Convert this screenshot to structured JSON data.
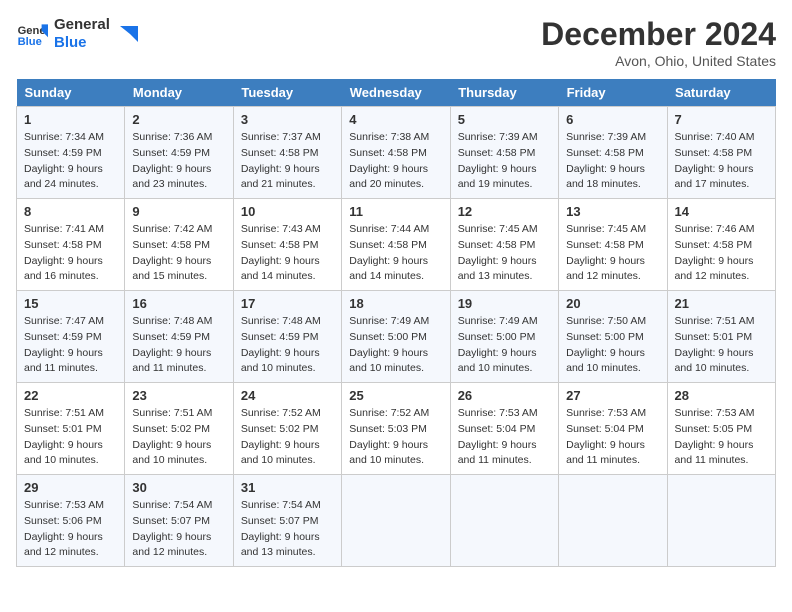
{
  "logo": {
    "line1": "General",
    "line2": "Blue"
  },
  "title": "December 2024",
  "location": "Avon, Ohio, United States",
  "days_of_week": [
    "Sunday",
    "Monday",
    "Tuesday",
    "Wednesday",
    "Thursday",
    "Friday",
    "Saturday"
  ],
  "weeks": [
    [
      {
        "day": 1,
        "sunrise": "7:34 AM",
        "sunset": "4:59 PM",
        "daylight": "9 hours and 24 minutes."
      },
      {
        "day": 2,
        "sunrise": "7:36 AM",
        "sunset": "4:59 PM",
        "daylight": "9 hours and 23 minutes."
      },
      {
        "day": 3,
        "sunrise": "7:37 AM",
        "sunset": "4:58 PM",
        "daylight": "9 hours and 21 minutes."
      },
      {
        "day": 4,
        "sunrise": "7:38 AM",
        "sunset": "4:58 PM",
        "daylight": "9 hours and 20 minutes."
      },
      {
        "day": 5,
        "sunrise": "7:39 AM",
        "sunset": "4:58 PM",
        "daylight": "9 hours and 19 minutes."
      },
      {
        "day": 6,
        "sunrise": "7:39 AM",
        "sunset": "4:58 PM",
        "daylight": "9 hours and 18 minutes."
      },
      {
        "day": 7,
        "sunrise": "7:40 AM",
        "sunset": "4:58 PM",
        "daylight": "9 hours and 17 minutes."
      }
    ],
    [
      {
        "day": 8,
        "sunrise": "7:41 AM",
        "sunset": "4:58 PM",
        "daylight": "9 hours and 16 minutes."
      },
      {
        "day": 9,
        "sunrise": "7:42 AM",
        "sunset": "4:58 PM",
        "daylight": "9 hours and 15 minutes."
      },
      {
        "day": 10,
        "sunrise": "7:43 AM",
        "sunset": "4:58 PM",
        "daylight": "9 hours and 14 minutes."
      },
      {
        "day": 11,
        "sunrise": "7:44 AM",
        "sunset": "4:58 PM",
        "daylight": "9 hours and 14 minutes."
      },
      {
        "day": 12,
        "sunrise": "7:45 AM",
        "sunset": "4:58 PM",
        "daylight": "9 hours and 13 minutes."
      },
      {
        "day": 13,
        "sunrise": "7:45 AM",
        "sunset": "4:58 PM",
        "daylight": "9 hours and 12 minutes."
      },
      {
        "day": 14,
        "sunrise": "7:46 AM",
        "sunset": "4:58 PM",
        "daylight": "9 hours and 12 minutes."
      }
    ],
    [
      {
        "day": 15,
        "sunrise": "7:47 AM",
        "sunset": "4:59 PM",
        "daylight": "9 hours and 11 minutes."
      },
      {
        "day": 16,
        "sunrise": "7:48 AM",
        "sunset": "4:59 PM",
        "daylight": "9 hours and 11 minutes."
      },
      {
        "day": 17,
        "sunrise": "7:48 AM",
        "sunset": "4:59 PM",
        "daylight": "9 hours and 10 minutes."
      },
      {
        "day": 18,
        "sunrise": "7:49 AM",
        "sunset": "5:00 PM",
        "daylight": "9 hours and 10 minutes."
      },
      {
        "day": 19,
        "sunrise": "7:49 AM",
        "sunset": "5:00 PM",
        "daylight": "9 hours and 10 minutes."
      },
      {
        "day": 20,
        "sunrise": "7:50 AM",
        "sunset": "5:00 PM",
        "daylight": "9 hours and 10 minutes."
      },
      {
        "day": 21,
        "sunrise": "7:51 AM",
        "sunset": "5:01 PM",
        "daylight": "9 hours and 10 minutes."
      }
    ],
    [
      {
        "day": 22,
        "sunrise": "7:51 AM",
        "sunset": "5:01 PM",
        "daylight": "9 hours and 10 minutes."
      },
      {
        "day": 23,
        "sunrise": "7:51 AM",
        "sunset": "5:02 PM",
        "daylight": "9 hours and 10 minutes."
      },
      {
        "day": 24,
        "sunrise": "7:52 AM",
        "sunset": "5:02 PM",
        "daylight": "9 hours and 10 minutes."
      },
      {
        "day": 25,
        "sunrise": "7:52 AM",
        "sunset": "5:03 PM",
        "daylight": "9 hours and 10 minutes."
      },
      {
        "day": 26,
        "sunrise": "7:53 AM",
        "sunset": "5:04 PM",
        "daylight": "9 hours and 11 minutes."
      },
      {
        "day": 27,
        "sunrise": "7:53 AM",
        "sunset": "5:04 PM",
        "daylight": "9 hours and 11 minutes."
      },
      {
        "day": 28,
        "sunrise": "7:53 AM",
        "sunset": "5:05 PM",
        "daylight": "9 hours and 11 minutes."
      }
    ],
    [
      {
        "day": 29,
        "sunrise": "7:53 AM",
        "sunset": "5:06 PM",
        "daylight": "9 hours and 12 minutes."
      },
      {
        "day": 30,
        "sunrise": "7:54 AM",
        "sunset": "5:07 PM",
        "daylight": "9 hours and 12 minutes."
      },
      {
        "day": 31,
        "sunrise": "7:54 AM",
        "sunset": "5:07 PM",
        "daylight": "9 hours and 13 minutes."
      },
      null,
      null,
      null,
      null
    ]
  ]
}
